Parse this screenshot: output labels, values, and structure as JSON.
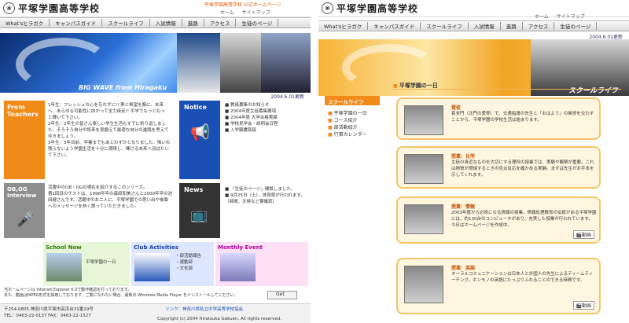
{
  "site_name": "平塚学園高等学校",
  "official_banner": "平塚学園高等学校 公式ホームページ",
  "subnav": [
    "ホーム",
    "サイトマップ"
  ],
  "nav": [
    "What'sヒラガク",
    "キャンパスガイド",
    "スクールライフ",
    "入試情報",
    "進路",
    "アクセス",
    "生徒のページ"
  ],
  "date": "2004.6.01更新",
  "left": {
    "hero_caption": "BIG WAVE from Hiragaku",
    "from_teachers": {
      "label": "From Teachers",
      "lines": [
        "1年生：フレッシュな心を忘れずに!! 夢と希望を胸に、未来",
        "へ、あらゆる可能性に向かって全力疾走!! 平学でもっともっ",
        "と輝いて下さい。",
        "2年生：2年生の皆さん楽しい学生生活もすでに折り返しまし",
        "た。そろそろ自分の将来を見据えて最適な自分の進路を考えて",
        "ゆきましょう。",
        "3年生：3年目前、卒業までもあとわずかとなりました。悔いの",
        "残らないよう学園生活を十分に満喫し、輝ける未来へ羽ばたい",
        "て下さい。"
      ]
    },
    "notice": {
      "label": "Notice",
      "items": [
        "教員募集のお知らせ",
        "2004年度生徒募集要項",
        "2004年度 大学合格実績",
        "学校見学会・説明会日程",
        "入学願書取扱"
      ]
    },
    "obog": {
      "label": "OB,OG Interview",
      "lines": [
        "活躍中のOB・OGの現在を紹介するこのシリーズ。",
        "第1回目のゲストは、1996年卒の森原和美さんと2000年卒の池",
        "田健さんです。活躍中のお二人に、平塚学園での思い出や後輩",
        "へのメッセージを熱く語っていただきました。"
      ]
    },
    "news": {
      "label": "News",
      "items": [
        "「生徒のページ」開設しました。",
        "9月25日（土）、体育祭が行われます。（時間、天候など要確認）"
      ]
    },
    "school_now": {
      "label": "School Now",
      "item": "平塚学園の一日"
    },
    "club": {
      "label": "Club Activities",
      "items": [
        "部活動報告",
        "運動部",
        "文化部"
      ]
    },
    "monthly": {
      "label": "Monthly Event"
    },
    "notes": [
      "当ホームページは Internet Explorer 6.0で動作確認を行っております。",
      "また、動画はMPEG形式を採用しております。ご覧になれない場合、最新の Windows Media Player をインストールしてください。"
    ],
    "get_button": "Get",
    "address": [
      "〒254-0805 神奈川県平塚市高浜台31番19号",
      "TEL：0463-22-0137 FAX：0463-22-1527"
    ],
    "link": "リンク：神奈川県私立中学高等学校協会",
    "copyright": "Copyright (c) 2004 Hiratsuka Gakuen, All rights reserved."
  },
  "right": {
    "hero_caption": "スクールライフ",
    "page_title": "平塚学園の一日",
    "side_label": "スクールライフ",
    "side_items": [
      "平塚学園の一日",
      "コース紹介",
      "部活動紹介",
      "行事カレンダー"
    ],
    "cards": [
      {
        "title": "登校",
        "desc": "喜多門（北門の愛称）で、交通指導の先生と「おはよう」の挨拶を交わすことから、平塚学園の学校生活は始まります。",
        "video": ""
      },
      {
        "title": "授業：化学",
        "desc": "生徒の身近なものを大切にする理科の授業では、実験や観察が重要。これは物質が燃焼するときの色炎反応を確かめる実験。まずは先生がお手本を示してくれます。",
        "video": ""
      },
      {
        "title": "授業：情報",
        "desc": "2003年度から必修になる情報の授業。情報処理教育の伝統がある平塚学園には、約130台のコンピュータがあり、充実した授業が行われています。今日はホームページを作成中。",
        "video": "動画"
      },
      {
        "title": "授業：英語",
        "desc": "オーラルコミュニケーションは日本人と外国人の先生によるティームティーチング。ホンモノの英語にたっぷりふれることのできる時間です。",
        "video": "動画"
      }
    ]
  }
}
